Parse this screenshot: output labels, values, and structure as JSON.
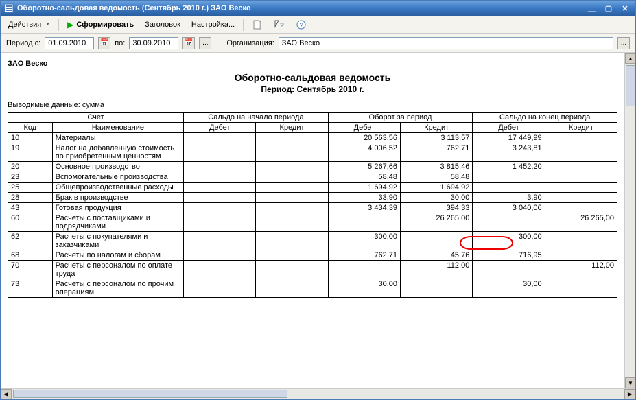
{
  "window": {
    "title": "Оборотно-сальдовая ведомость (Сентябрь 2010 г.) ЗАО Веско"
  },
  "toolbar": {
    "actions": "Действия",
    "generate": "Сформировать",
    "header": "Заголовок",
    "settings": "Настройка..."
  },
  "filter": {
    "period_from_label": "Период с:",
    "date_from": "01.09.2010",
    "to_label": "по:",
    "date_to": "30.09.2010",
    "org_label": "Организация:",
    "org_value": "ЗАО Веско",
    "dots": "..."
  },
  "doc": {
    "company": "ЗАО Веско",
    "title": "Оборотно-сальдовая ведомость",
    "period": "Период: Сентябрь 2010 г.",
    "note": "Выводимые данные: сумма"
  },
  "table": {
    "group_account": "Счет",
    "group_open": "Сальдо на начало периода",
    "group_turn": "Оборот за период",
    "group_close": "Сальдо на конец периода",
    "col_code": "Код",
    "col_name": "Наименование",
    "col_debit": "Дебет",
    "col_credit": "Кредит",
    "rows": [
      {
        "code": "10",
        "name": "Материалы",
        "od": "",
        "oc": "",
        "td": "20 563,56",
        "tc": "3 113,57",
        "cd": "17 449,99",
        "cc": ""
      },
      {
        "code": "19",
        "name": "Налог на добавленную стоимость по приобретенным ценностям",
        "od": "",
        "oc": "",
        "td": "4 006,52",
        "tc": "762,71",
        "cd": "3 243,81",
        "cc": ""
      },
      {
        "code": "20",
        "name": "Основное производство",
        "od": "",
        "oc": "",
        "td": "5 267,66",
        "tc": "3 815,46",
        "cd": "1 452,20",
        "cc": ""
      },
      {
        "code": "23",
        "name": "Вспомогательные производства",
        "od": "",
        "oc": "",
        "td": "58,48",
        "tc": "58,48",
        "cd": "",
        "cc": ""
      },
      {
        "code": "25",
        "name": "Общепроизводственные расходы",
        "od": "",
        "oc": "",
        "td": "1 694,92",
        "tc": "1 694,92",
        "cd": "",
        "cc": ""
      },
      {
        "code": "28",
        "name": "Брак в производстве",
        "od": "",
        "oc": "",
        "td": "33,90",
        "tc": "30,00",
        "cd": "3,90",
        "cc": ""
      },
      {
        "code": "43",
        "name": "Готовая продукция",
        "od": "",
        "oc": "",
        "td": "3 434,39",
        "tc": "394,33",
        "cd": "3 040,06",
        "cc": ""
      },
      {
        "code": "60",
        "name": "Расчеты с поставщиками и подрядчиками",
        "od": "",
        "oc": "",
        "td": "",
        "tc": "26 265,00",
        "cd": "",
        "cc": "26 265,00"
      },
      {
        "code": "62",
        "name": "Расчеты с покупателями и заказчиками",
        "od": "",
        "oc": "",
        "td": "300,00",
        "tc": "",
        "cd": "300,00",
        "cc": ""
      },
      {
        "code": "68",
        "name": "Расчеты по налогам и сборам",
        "od": "",
        "oc": "",
        "td": "762,71",
        "tc": "45,76",
        "cd": "716,95",
        "cc": ""
      },
      {
        "code": "70",
        "name": "Расчеты с персоналом по оплате труда",
        "od": "",
        "oc": "",
        "td": "",
        "tc": "112,00",
        "cd": "",
        "cc": "112,00"
      },
      {
        "code": "73",
        "name": "Расчеты с персоналом по прочим операциям",
        "od": "",
        "oc": "",
        "td": "30,00",
        "tc": "",
        "cd": "30,00",
        "cc": ""
      }
    ]
  },
  "chart_data": {
    "type": "table",
    "title": "Оборотно-сальдовая ведомость — Сентябрь 2010 г., ЗАО Веско",
    "columns": [
      "Код",
      "Наименование",
      "Сальдо нач. Дебет",
      "Сальдо нач. Кредит",
      "Оборот Дебет",
      "Оборот Кредит",
      "Сальдо кон. Дебет",
      "Сальдо кон. Кредит"
    ],
    "rows": [
      [
        "10",
        "Материалы",
        null,
        null,
        20563.56,
        3113.57,
        17449.99,
        null
      ],
      [
        "19",
        "НДС по приобретенным ценностям",
        null,
        null,
        4006.52,
        762.71,
        3243.81,
        null
      ],
      [
        "20",
        "Основное производство",
        null,
        null,
        5267.66,
        3815.46,
        1452.2,
        null
      ],
      [
        "23",
        "Вспомогательные производства",
        null,
        null,
        58.48,
        58.48,
        null,
        null
      ],
      [
        "25",
        "Общепроизводственные расходы",
        null,
        null,
        1694.92,
        1694.92,
        null,
        null
      ],
      [
        "28",
        "Брак в производстве",
        null,
        null,
        33.9,
        30.0,
        3.9,
        null
      ],
      [
        "43",
        "Готовая продукция",
        null,
        null,
        3434.39,
        394.33,
        3040.06,
        null
      ],
      [
        "60",
        "Расчеты с поставщиками и подрядчиками",
        null,
        null,
        null,
        26265.0,
        null,
        26265.0
      ],
      [
        "62",
        "Расчеты с покупателями и заказчиками",
        null,
        null,
        300.0,
        null,
        300.0,
        null
      ],
      [
        "68",
        "Расчеты по налогам и сборам",
        null,
        null,
        762.71,
        45.76,
        716.95,
        null
      ],
      [
        "70",
        "Расчеты с персоналом по оплате труда",
        null,
        null,
        null,
        112.0,
        null,
        112.0
      ],
      [
        "73",
        "Расчеты с персоналом по прочим операциям",
        null,
        null,
        30.0,
        null,
        30.0,
        null
      ]
    ]
  }
}
